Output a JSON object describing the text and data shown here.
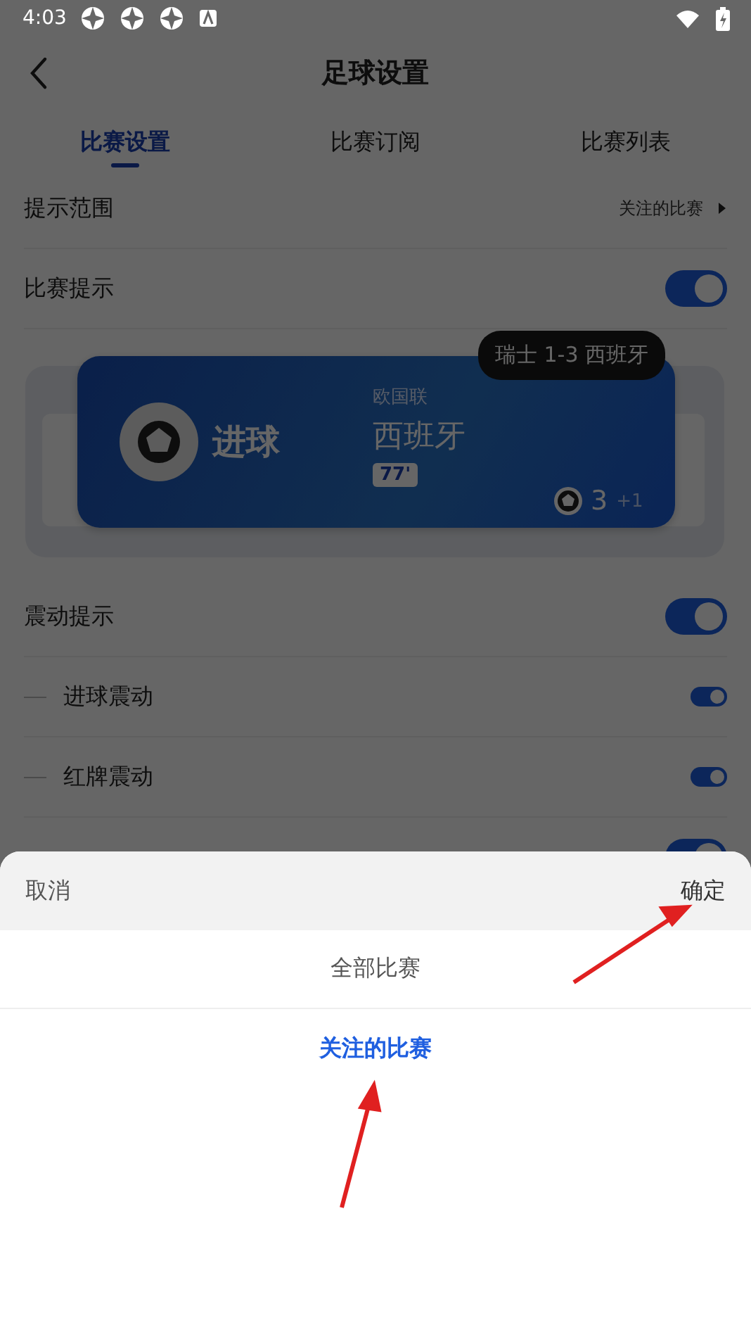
{
  "status_bar": {
    "time": "4:03"
  },
  "header": {
    "title": "足球设置"
  },
  "tabs": [
    {
      "label": "比赛设置",
      "selected": true
    },
    {
      "label": "比赛订阅",
      "selected": false
    },
    {
      "label": "比赛列表",
      "selected": false
    }
  ],
  "settings": [
    {
      "kind": "select",
      "label": "提示范围",
      "value": "关注的比赛"
    },
    {
      "kind": "toggle",
      "label": "比赛提示",
      "on": true
    },
    {
      "kind": "preview",
      "event": "进球",
      "league": "欧国联",
      "team": "西班牙",
      "minute": "77'",
      "goals": "3",
      "extra": "+1",
      "toast": "瑞士 1-3 西班牙"
    },
    {
      "kind": "toggle",
      "label": "震动提示",
      "on": true
    },
    {
      "kind": "subtoggle",
      "label": "进球震动",
      "on": true
    },
    {
      "kind": "subtoggle",
      "label": "红牌震动",
      "on": true
    },
    {
      "kind": "toggle",
      "on": true
    }
  ],
  "sheet": {
    "cancel": "取消",
    "confirm": "确定",
    "options": [
      {
        "label": "全部比赛",
        "selected": false
      },
      {
        "label": "关注的比赛",
        "selected": true
      }
    ]
  }
}
